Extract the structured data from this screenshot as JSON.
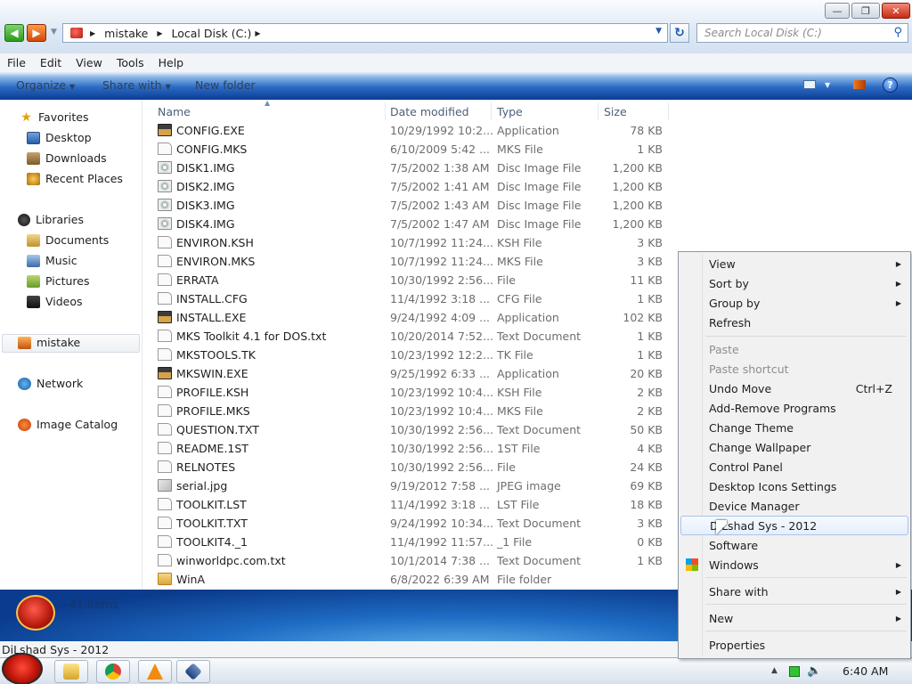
{
  "window": {
    "address": {
      "crumbs": [
        "mistake",
        "Local Disk (C:)"
      ]
    },
    "search_placeholder": "Search Local Disk (C:)",
    "menu": [
      "File",
      "Edit",
      "View",
      "Tools",
      "Help"
    ],
    "commands": {
      "organize": "Organize",
      "share_with": "Share with",
      "new_folder": "New folder"
    }
  },
  "nav": {
    "favorites": "Favorites",
    "desktop": "Desktop",
    "downloads": "Downloads",
    "recent_places": "Recent Places",
    "libraries": "Libraries",
    "documents": "Documents",
    "music": "Music",
    "pictures": "Pictures",
    "videos": "Videos",
    "mistake": "mistake",
    "network": "Network",
    "image_catalog": "Image Catalog"
  },
  "columns": {
    "name": "Name",
    "date": "Date modified",
    "type": "Type",
    "size": "Size"
  },
  "files": [
    {
      "name": "CONFIG.EXE",
      "date": "10/29/1992 10:2...",
      "type": "Application",
      "size": "78 KB",
      "icon": "app"
    },
    {
      "name": "CONFIG.MKS",
      "date": "6/10/2009 5:42 ...",
      "type": "MKS File",
      "size": "1 KB",
      "icon": "doc"
    },
    {
      "name": "DISK1.IMG",
      "date": "7/5/2002 1:38 AM",
      "type": "Disc Image File",
      "size": "1,200 KB",
      "icon": "disc"
    },
    {
      "name": "DISK2.IMG",
      "date": "7/5/2002 1:41 AM",
      "type": "Disc Image File",
      "size": "1,200 KB",
      "icon": "disc"
    },
    {
      "name": "DISK3.IMG",
      "date": "7/5/2002 1:43 AM",
      "type": "Disc Image File",
      "size": "1,200 KB",
      "icon": "disc"
    },
    {
      "name": "DISK4.IMG",
      "date": "7/5/2002 1:47 AM",
      "type": "Disc Image File",
      "size": "1,200 KB",
      "icon": "disc"
    },
    {
      "name": "ENVIRON.KSH",
      "date": "10/7/1992 11:24...",
      "type": "KSH File",
      "size": "3 KB",
      "icon": "doc"
    },
    {
      "name": "ENVIRON.MKS",
      "date": "10/7/1992 11:24...",
      "type": "MKS File",
      "size": "3 KB",
      "icon": "doc"
    },
    {
      "name": "ERRATA",
      "date": "10/30/1992 2:56...",
      "type": "File",
      "size": "11 KB",
      "icon": "doc"
    },
    {
      "name": "INSTALL.CFG",
      "date": "11/4/1992 3:18 ...",
      "type": "CFG File",
      "size": "1 KB",
      "icon": "doc"
    },
    {
      "name": "INSTALL.EXE",
      "date": "9/24/1992 4:09 ...",
      "type": "Application",
      "size": "102 KB",
      "icon": "app"
    },
    {
      "name": "MKS Toolkit 4.1 for DOS.txt",
      "date": "10/20/2014 7:52...",
      "type": "Text Document",
      "size": "1 KB",
      "icon": "doc"
    },
    {
      "name": "MKSTOOLS.TK",
      "date": "10/23/1992 12:2...",
      "type": "TK File",
      "size": "1 KB",
      "icon": "doc"
    },
    {
      "name": "MKSWIN.EXE",
      "date": "9/25/1992 6:33 ...",
      "type": "Application",
      "size": "20 KB",
      "icon": "app"
    },
    {
      "name": "PROFILE.KSH",
      "date": "10/23/1992 10:4...",
      "type": "KSH File",
      "size": "2 KB",
      "icon": "doc"
    },
    {
      "name": "PROFILE.MKS",
      "date": "10/23/1992 10:4...",
      "type": "MKS File",
      "size": "2 KB",
      "icon": "doc"
    },
    {
      "name": "QUESTION.TXT",
      "date": "10/30/1992 2:56...",
      "type": "Text Document",
      "size": "50 KB",
      "icon": "doc"
    },
    {
      "name": "README.1ST",
      "date": "10/30/1992 2:56...",
      "type": "1ST File",
      "size": "4 KB",
      "icon": "doc"
    },
    {
      "name": "RELNOTES",
      "date": "10/30/1992 2:56...",
      "type": "File",
      "size": "24 KB",
      "icon": "doc"
    },
    {
      "name": "serial.jpg",
      "date": "9/19/2012 7:58 ...",
      "type": "JPEG image",
      "size": "69 KB",
      "icon": "jpg"
    },
    {
      "name": "TOOLKIT.LST",
      "date": "11/4/1992 3:18 ...",
      "type": "LST File",
      "size": "18 KB",
      "icon": "doc"
    },
    {
      "name": "TOOLKIT.TXT",
      "date": "9/24/1992 10:34...",
      "type": "Text Document",
      "size": "3 KB",
      "icon": "doc"
    },
    {
      "name": "TOOLKIT4._1",
      "date": "11/4/1992 11:57...",
      "type": "_1 File",
      "size": "0 KB",
      "icon": "doc"
    },
    {
      "name": "winworldpc.com.txt",
      "date": "10/1/2014 7:38 ...",
      "type": "Text Document",
      "size": "1 KB",
      "icon": "doc"
    },
    {
      "name": "WinA",
      "date": "6/8/2022 6:39 AM",
      "type": "File folder",
      "size": "",
      "icon": "folder"
    }
  ],
  "details": {
    "item_count": "41 items"
  },
  "status": "DiLshad Sys - 2012",
  "taskbar": {
    "clock": "6:40 AM"
  },
  "context_menu": {
    "view": "View",
    "sort_by": "Sort by",
    "group_by": "Group by",
    "refresh": "Refresh",
    "paste": "Paste",
    "paste_shortcut": "Paste shortcut",
    "undo_move": "Undo Move",
    "undo_shortcut": "Ctrl+Z",
    "add_remove": "Add-Remove Programs",
    "change_theme": "Change Theme",
    "change_wallpaper": "Change Wallpaper",
    "control_panel": "Control Panel",
    "desktop_icons": "Desktop Icons Settings",
    "device_manager": "Device Manager",
    "dilshad": "DiLshad Sys - 2012",
    "software": "Software",
    "windows": "Windows",
    "share_with": "Share with",
    "new": "New",
    "properties": "Properties"
  }
}
